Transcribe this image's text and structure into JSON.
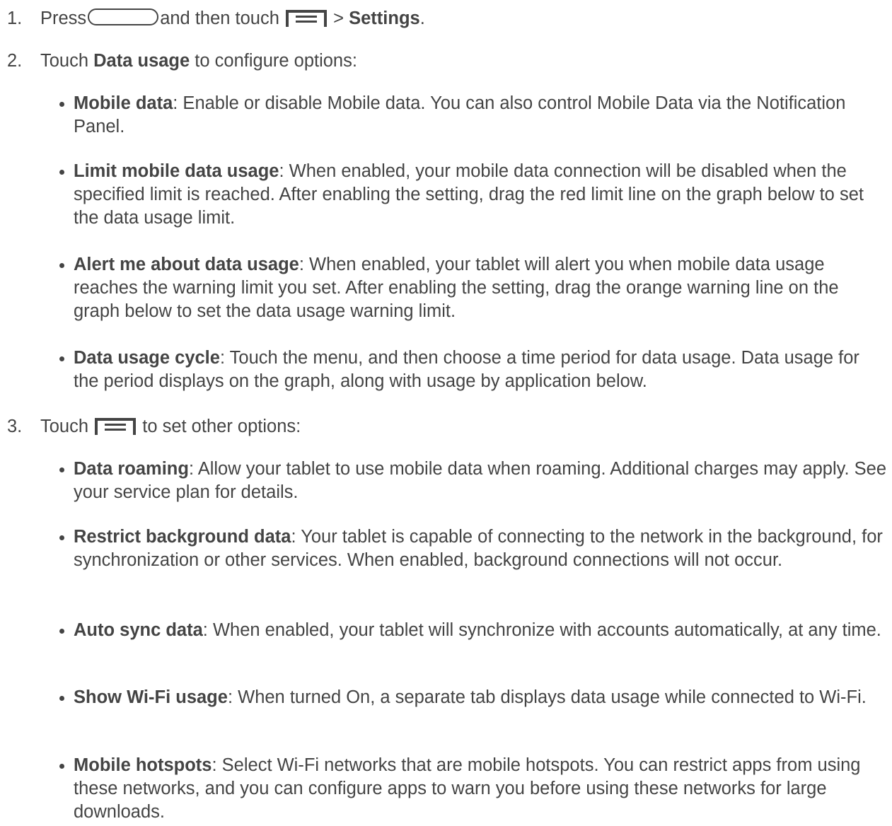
{
  "steps": [
    {
      "number": "1.",
      "press": "Press",
      "home_key_icon": "home-key-icon",
      "and_then_touch": "and then touch",
      "menu_key_icon": "menu-key-icon",
      "separator": ">",
      "settings": "Settings",
      "end": "."
    },
    {
      "number": "2.",
      "touch": "Touch",
      "data_usage": "Data usage",
      "rest": "to configure options:",
      "bullets": [
        {
          "term": "Mobile data",
          "desc": ": Enable or disable Mobile data. You can also control Mobile Data via the Notification Panel."
        },
        {
          "term": "Limit mobile data usage",
          "desc": ": When enabled, your mobile data connection will be disabled when the specified limit is reached. After enabling the setting, drag the red limit line on the graph below to set the data usage limit."
        },
        {
          "term": "Alert me about data usage",
          "desc": ": When enabled, your tablet will alert you when mobile data usage reaches the warning limit you set. After enabling the setting, drag the orange warning line on the graph below to set the data usage warning limit."
        },
        {
          "term": "Data usage cycle",
          "desc": ": Touch the menu, and then choose a time period for data usage. Data usage for the period displays on the graph, along with usage by application below."
        }
      ]
    },
    {
      "number": "3.",
      "touch": "Touch",
      "menu_key_icon": "menu-key-icon",
      "rest": "to set other options:",
      "bullets": [
        {
          "term": "Data roaming",
          "desc": ": Allow your tablet to use mobile data when roaming. Additional charges may apply. See your service plan for details."
        },
        {
          "term": "Restrict background data",
          "desc": ": Your tablet is capable of connecting to the network in the background, for synchronization or other services. When enabled, background connections will not occur."
        },
        {
          "term": "Auto sync data",
          "desc": ": When enabled, your tablet will synchronize with accounts automatically, at any time."
        },
        {
          "term": "Show Wi-Fi usage",
          "desc": ": When turned On, a separate tab displays data usage while connected to Wi-Fi."
        },
        {
          "term": "Mobile hotspots",
          "desc": ": Select Wi-Fi networks that are mobile hotspots. You can restrict apps from using these networks, and you can configure apps to warn you before using these networks for large downloads."
        }
      ]
    }
  ]
}
